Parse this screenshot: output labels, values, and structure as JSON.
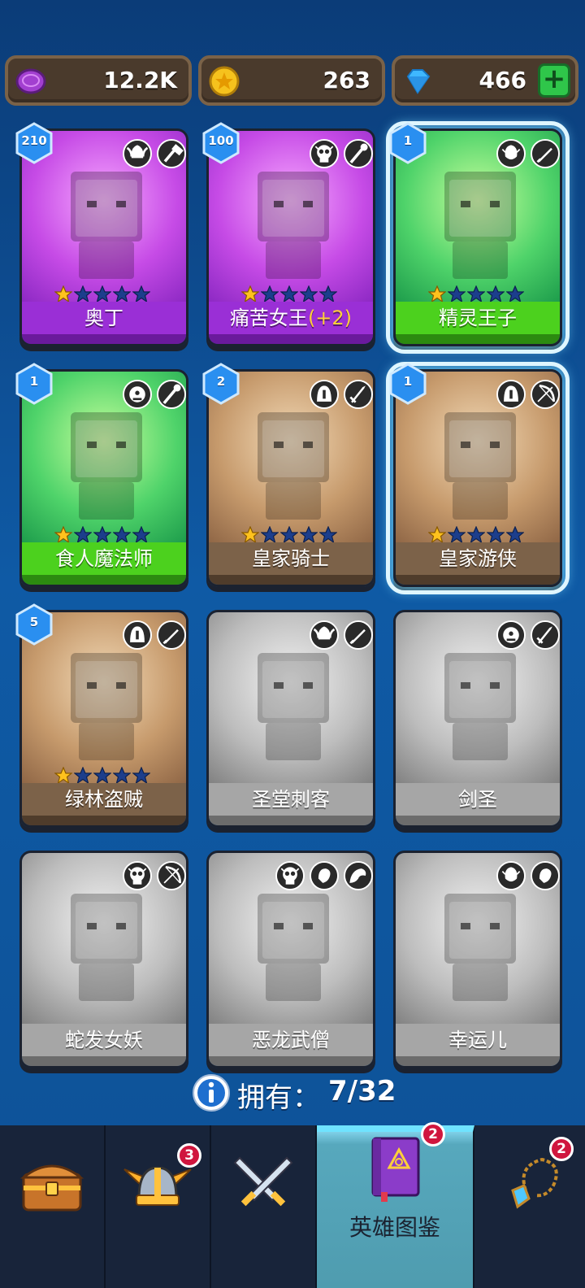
{
  "currency": {
    "gems_purple": "12.2K",
    "coins": "263",
    "diamonds": "466",
    "plus": "+"
  },
  "cards": [
    {
      "name": "奥丁",
      "bonus": "",
      "level": "210",
      "theme": "purple",
      "stars": 1,
      "classes": [
        "wing-helm-icon",
        "hammer-icon"
      ],
      "selected": false
    },
    {
      "name": "痛苦女王",
      "bonus": "(+2)",
      "level": "100",
      "theme": "purple",
      "stars": 1,
      "classes": [
        "skull-icon",
        "staff-icon"
      ],
      "selected": false
    },
    {
      "name": "精灵王子",
      "bonus": "",
      "level": "1",
      "theme": "green",
      "stars": 1,
      "classes": [
        "elf-icon",
        "dagger-icon"
      ],
      "selected": true
    },
    {
      "name": "食人魔法师",
      "bonus": "",
      "level": "1",
      "theme": "green",
      "stars": 1,
      "classes": [
        "ogre-icon",
        "staff-icon"
      ],
      "selected": false
    },
    {
      "name": "皇家骑士",
      "bonus": "",
      "level": "2",
      "theme": "brown",
      "stars": 1,
      "classes": [
        "helmet-icon",
        "sword-icon"
      ],
      "selected": false
    },
    {
      "name": "皇家游侠",
      "bonus": "",
      "level": "1",
      "theme": "brown",
      "stars": 1,
      "classes": [
        "helmet-icon",
        "bow-icon"
      ],
      "selected": true
    },
    {
      "name": "绿林盗贼",
      "bonus": "",
      "level": "5",
      "theme": "brown",
      "stars": 1,
      "classes": [
        "helmet-icon",
        "dagger-icon"
      ],
      "selected": false
    },
    {
      "name": "圣堂刺客",
      "bonus": "",
      "level": "",
      "theme": "grey",
      "stars": 0,
      "classes": [
        "wing-helm-icon",
        "dagger-icon"
      ],
      "selected": false
    },
    {
      "name": "剑圣",
      "bonus": "",
      "level": "",
      "theme": "grey",
      "stars": 0,
      "classes": [
        "ogre-icon",
        "sword-icon"
      ],
      "selected": false
    },
    {
      "name": "蛇发女妖",
      "bonus": "",
      "level": "",
      "theme": "grey",
      "stars": 0,
      "classes": [
        "skull-icon",
        "bow-icon"
      ],
      "selected": false
    },
    {
      "name": "恶龙武僧",
      "bonus": "",
      "level": "",
      "theme": "grey",
      "stars": 0,
      "classes": [
        "skull-icon",
        "fist-icon",
        "dragon-icon"
      ],
      "selected": false
    },
    {
      "name": "幸运儿",
      "bonus": "",
      "level": "",
      "theme": "grey",
      "stars": 0,
      "classes": [
        "elf-icon",
        "fist-icon"
      ],
      "selected": false
    }
  ],
  "owned": {
    "label": "拥有：",
    "count": "7/32"
  },
  "nav": {
    "tabs": [
      {
        "name": "chest",
        "label": "",
        "badge": ""
      },
      {
        "name": "heroes",
        "label": "",
        "badge": "3"
      },
      {
        "name": "battle",
        "label": "",
        "badge": ""
      },
      {
        "name": "codex",
        "label": "英雄图鉴",
        "badge": "2"
      },
      {
        "name": "amulet",
        "label": "",
        "badge": "2"
      }
    ]
  },
  "colors": {
    "background": "#0f5aa5",
    "purple_card": "#9a2fd6",
    "green_card": "#4cd11e",
    "brown_card": "#7c6249",
    "grey_card": "#a6a6a6",
    "active_tab": "#57a8bd",
    "badge": "#d0163e"
  }
}
